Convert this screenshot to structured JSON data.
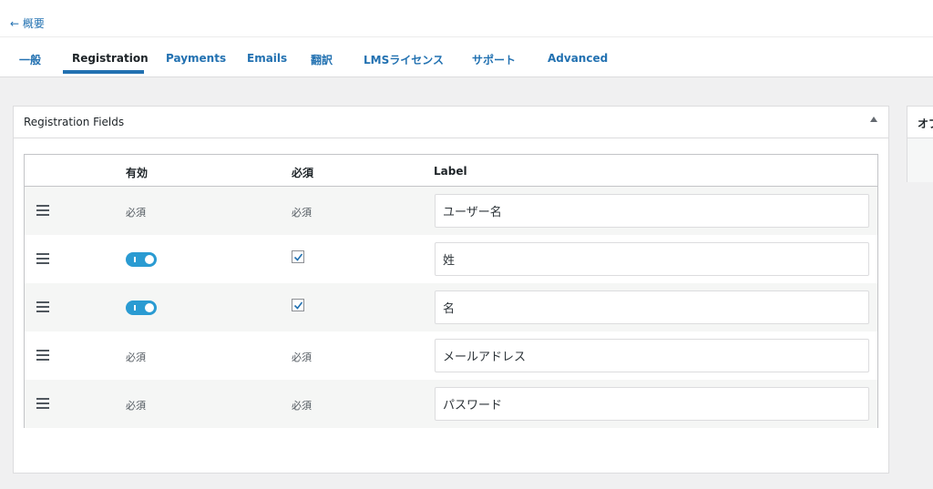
{
  "nav": {
    "back_link": "← 概要"
  },
  "tabs": [
    {
      "label": "一般"
    },
    {
      "label": "Registration"
    },
    {
      "label": "Payments"
    },
    {
      "label": "Emails"
    },
    {
      "label": "翻訳"
    },
    {
      "label": "LMSライセンス"
    },
    {
      "label": "サポート"
    },
    {
      "label": "Advanced"
    }
  ],
  "active_tab": "Registration",
  "panel": {
    "title": "Registration Fields",
    "columns": {
      "enabled": "有効",
      "required": "必須",
      "label": "Label"
    },
    "rows": [
      {
        "enabled_text": "必須",
        "required_text": "必須",
        "label_value": "ユーザー名"
      },
      {
        "enabled_toggle": true,
        "required_checked": true,
        "label_value": "姓"
      },
      {
        "enabled_toggle": true,
        "required_checked": true,
        "label_value": "名"
      },
      {
        "enabled_text": "必須",
        "required_text": "必須",
        "label_value": "メールアドレス"
      },
      {
        "enabled_text": "必須",
        "required_text": "必須",
        "label_value": "パスワード"
      }
    ]
  },
  "side_panel": {
    "title": "オプ"
  },
  "colors": {
    "accent": "#2271b1",
    "toggle_on": "#2a9bd2",
    "background": "#f0f0f1"
  }
}
